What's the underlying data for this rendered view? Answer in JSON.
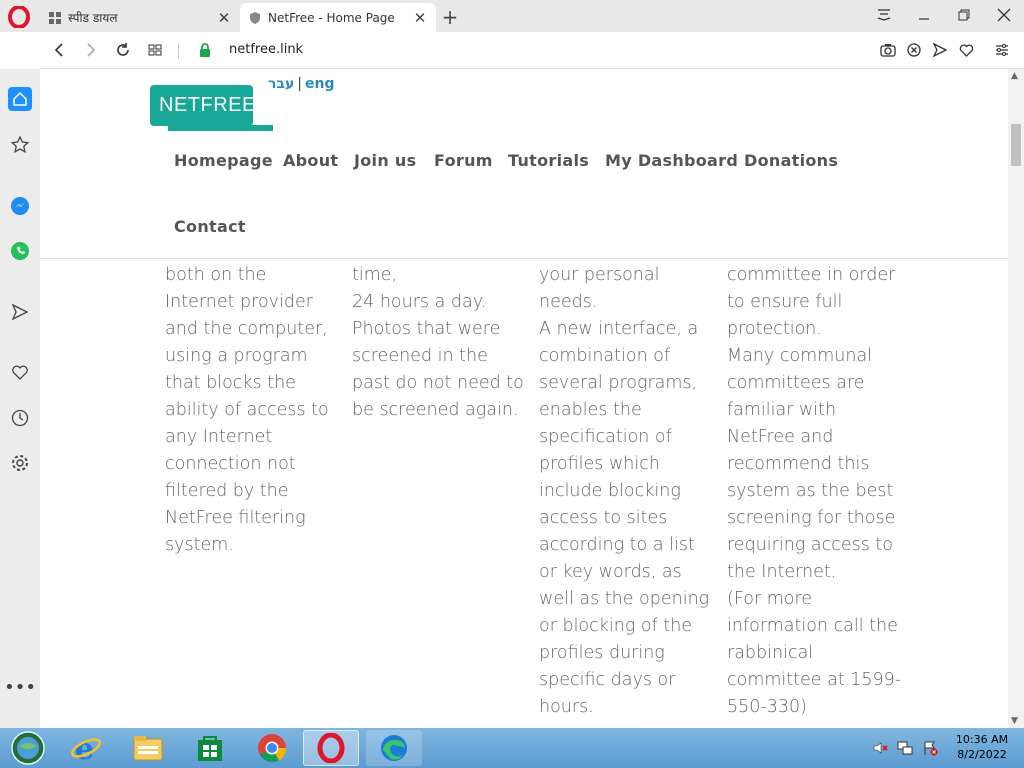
{
  "browser": {
    "tabs": [
      {
        "label": "स्पीड डायल",
        "active": false
      },
      {
        "label": "NetFree - Home Page",
        "active": true
      }
    ],
    "url": "netfree.link"
  },
  "site": {
    "logo_text": "NETFREE",
    "lang_hebrew": "עבר",
    "lang_separator": "|",
    "lang_english": "eng",
    "menu": [
      "Homepage",
      "About",
      "Join us",
      "Forum",
      "Tutorials",
      "My Dashboard",
      "Donations",
      "Contact"
    ]
  },
  "columns": [
    [
      "both on the",
      "Internet provider",
      "and the computer,",
      "using a program",
      "that blocks the",
      "ability of access to",
      "any Internet",
      "connection not",
      "filtered by the",
      "NetFree filtering",
      "system."
    ],
    [
      "time,",
      "24 hours a day.",
      "Photos that were",
      "screened in the",
      "past do not need to",
      "be screened again."
    ],
    [
      "your personal",
      "needs.",
      "A new interface, a",
      "combination of",
      "several programs,",
      "enables the",
      "specification of",
      "profiles which",
      "include blocking",
      "access to sites",
      "according to a list",
      "or key words, as",
      "well as the opening",
      "or blocking of the",
      "profiles during",
      "specific days or",
      "hours."
    ],
    [
      "committee in order",
      "to ensure full",
      "protection.",
      "Many communal",
      "committees are",
      "familiar with",
      "NetFree and",
      "recommend this",
      "system as the best",
      "screening for those",
      "requiring access to",
      "the Internet.",
      "(For more",
      "information call the",
      "rabbinical",
      "committee at 1599-",
      "550-330)"
    ]
  ],
  "taskbar": {
    "time": "10:36 AM",
    "date": "8/2/2022"
  },
  "colors": {
    "brand": "#18a898",
    "lang_link": "#2a8abf",
    "body_text": "#666666",
    "menu_text": "#555555"
  }
}
